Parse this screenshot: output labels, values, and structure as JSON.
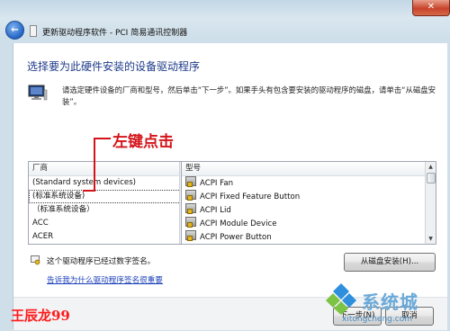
{
  "window": {
    "title": "更新驱动程序软件 - PCI 简易通讯控制器",
    "close_symbol": "✕",
    "back_symbol": "←"
  },
  "main": {
    "heading": "选择要为此硬件安装的设备驱动程序",
    "instruction": "请选定硬件设备的厂商和型号，然后单击“下一步”。如果手头有包含要安装的驱动程序的磁盘，请单击“从磁盘安装”。"
  },
  "annotation": {
    "text": "左键点击",
    "color": "#d3141a"
  },
  "manufacturer_list": {
    "header": "厂商",
    "items": [
      "(Standard system devices)",
      "(标准系统设备)",
      "（标准系统设备）",
      "ACC",
      "ACER"
    ],
    "selected_index": 1
  },
  "model_list": {
    "header": "型号",
    "items": [
      "ACPI Fan",
      "ACPI Fixed Feature Button",
      "ACPI Lid",
      "ACPI Module Device",
      "ACPI Power Button"
    ]
  },
  "driver_info": {
    "signed_text": "这个驱动程序已经过数字签名。",
    "why_link": "告诉我为什么驱动程序签名很重要",
    "disk_button": "从磁盘安装(H)..."
  },
  "footer": {
    "next_button": "下一步(N)",
    "cancel_button": "取消"
  },
  "overlay": {
    "signature": "王辰龙99",
    "watermark_text": "系统城",
    "watermark_url": "xitongcheng.com"
  },
  "colors": {
    "heading": "#1e3a8a",
    "link": "#1a3fb8",
    "annotation": "#d3141a",
    "watermark": "#6aa9d8"
  }
}
